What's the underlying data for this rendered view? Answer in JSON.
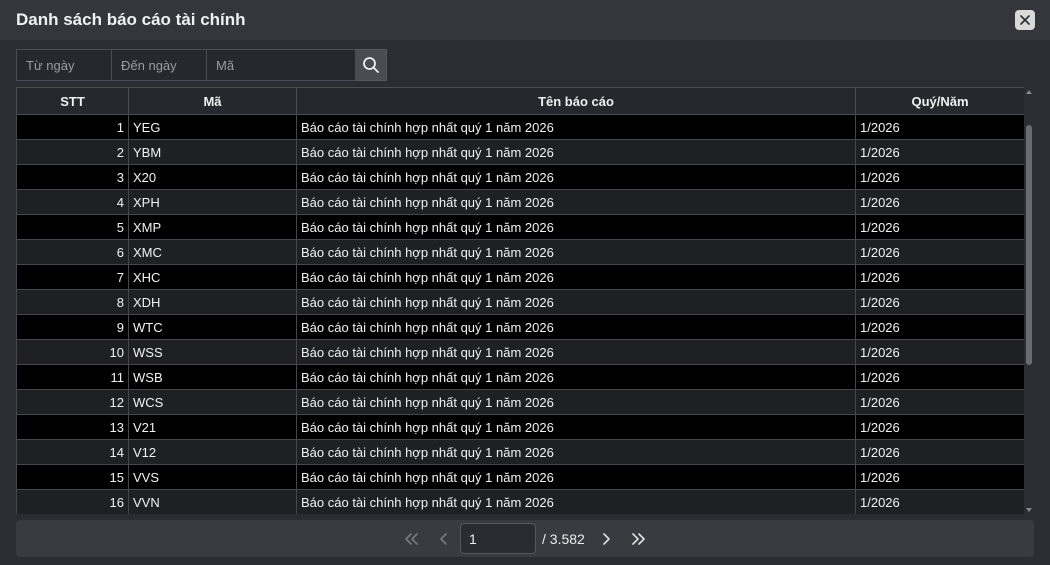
{
  "dialog": {
    "title": "Danh sách báo cáo tài chính"
  },
  "filters": {
    "from_date_placeholder": "Từ ngày",
    "to_date_placeholder": "Đến ngày",
    "code_placeholder": "Mã"
  },
  "table": {
    "headers": [
      "STT",
      "Mã",
      "Tên báo cáo",
      "Quý/Năm"
    ],
    "rows": [
      {
        "stt": "1",
        "code": "YEG",
        "name": "Báo cáo tài chính hợp nhất quý 1 năm 2026",
        "period": "1/2026"
      },
      {
        "stt": "2",
        "code": "YBM",
        "name": "Báo cáo tài chính hợp nhất quý 1 năm 2026",
        "period": "1/2026"
      },
      {
        "stt": "3",
        "code": "X20",
        "name": "Báo cáo tài chính hợp nhất quý 1 năm 2026",
        "period": "1/2026"
      },
      {
        "stt": "4",
        "code": "XPH",
        "name": "Báo cáo tài chính hợp nhất quý 1 năm 2026",
        "period": "1/2026"
      },
      {
        "stt": "5",
        "code": "XMP",
        "name": "Báo cáo tài chính hợp nhất quý 1 năm 2026",
        "period": "1/2026"
      },
      {
        "stt": "6",
        "code": "XMC",
        "name": "Báo cáo tài chính hợp nhất quý 1 năm 2026",
        "period": "1/2026"
      },
      {
        "stt": "7",
        "code": "XHC",
        "name": "Báo cáo tài chính hợp nhất quý 1 năm 2026",
        "period": "1/2026"
      },
      {
        "stt": "8",
        "code": "XDH",
        "name": "Báo cáo tài chính hợp nhất quý 1 năm 2026",
        "period": "1/2026"
      },
      {
        "stt": "9",
        "code": "WTC",
        "name": "Báo cáo tài chính hợp nhất quý 1 năm 2026",
        "period": "1/2026"
      },
      {
        "stt": "10",
        "code": "WSS",
        "name": "Báo cáo tài chính hợp nhất quý 1 năm 2026",
        "period": "1/2026"
      },
      {
        "stt": "11",
        "code": "WSB",
        "name": "Báo cáo tài chính hợp nhất quý 1 năm 2026",
        "period": "1/2026"
      },
      {
        "stt": "12",
        "code": "WCS",
        "name": "Báo cáo tài chính hợp nhất quý 1 năm 2026",
        "period": "1/2026"
      },
      {
        "stt": "13",
        "code": "V21",
        "name": "Báo cáo tài chính hợp nhất quý 1 năm 2026",
        "period": "1/2026"
      },
      {
        "stt": "14",
        "code": "V12",
        "name": "Báo cáo tài chính hợp nhất quý 1 năm 2026",
        "period": "1/2026"
      },
      {
        "stt": "15",
        "code": "VVS",
        "name": "Báo cáo tài chính hợp nhất quý 1 năm 2026",
        "period": "1/2026"
      },
      {
        "stt": "16",
        "code": "VVN",
        "name": "Báo cáo tài chính hợp nhất quý 1 năm 2026",
        "period": "1/2026"
      }
    ]
  },
  "pagination": {
    "current_page": "1",
    "total_label": "/ 3.582"
  },
  "icons": {
    "close": "close-icon",
    "search": "search-icon",
    "first": "double-chevron-left-icon",
    "prev": "chevron-left-icon",
    "next": "chevron-right-icon",
    "last": "double-chevron-right-icon"
  },
  "colors": {
    "background": "#2b2d33",
    "titlebar": "#34363c",
    "row_odd": "#000000",
    "row_even": "#1f2024",
    "pager": "#393b41"
  }
}
